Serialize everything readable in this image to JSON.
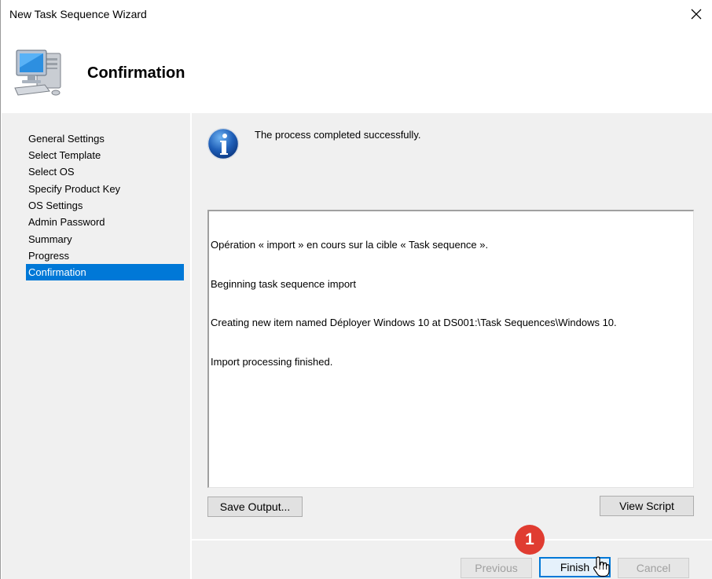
{
  "window": {
    "title": "New Task Sequence Wizard"
  },
  "header": {
    "title": "Confirmation",
    "icon": "computer-icon"
  },
  "nav": {
    "items": [
      {
        "label": "General Settings",
        "active": false
      },
      {
        "label": "Select Template",
        "active": false
      },
      {
        "label": "Select OS",
        "active": false
      },
      {
        "label": "Specify Product Key",
        "active": false
      },
      {
        "label": "OS Settings",
        "active": false
      },
      {
        "label": "Admin Password",
        "active": false
      },
      {
        "label": "Summary",
        "active": false
      },
      {
        "label": "Progress",
        "active": false
      },
      {
        "label": "Confirmation",
        "active": true
      }
    ]
  },
  "main": {
    "status": "The process completed successfully.",
    "output_lines": [
      "Opération « import » en cours sur la cible « Task sequence ».",
      "Beginning task sequence import",
      "Creating new item named Déployer Windows 10 at DS001:\\Task Sequences\\Windows 10.",
      "Import processing finished."
    ],
    "save_output_label": "Save Output...",
    "view_script_label": "View Script"
  },
  "footer": {
    "previous_label": "Previous",
    "finish_label": "Finish",
    "cancel_label": "Cancel"
  },
  "annotation": {
    "badge_number": "1"
  },
  "colors": {
    "selection": "#0078d7",
    "badge": "#e03c31",
    "panel": "#f0f0f0"
  }
}
